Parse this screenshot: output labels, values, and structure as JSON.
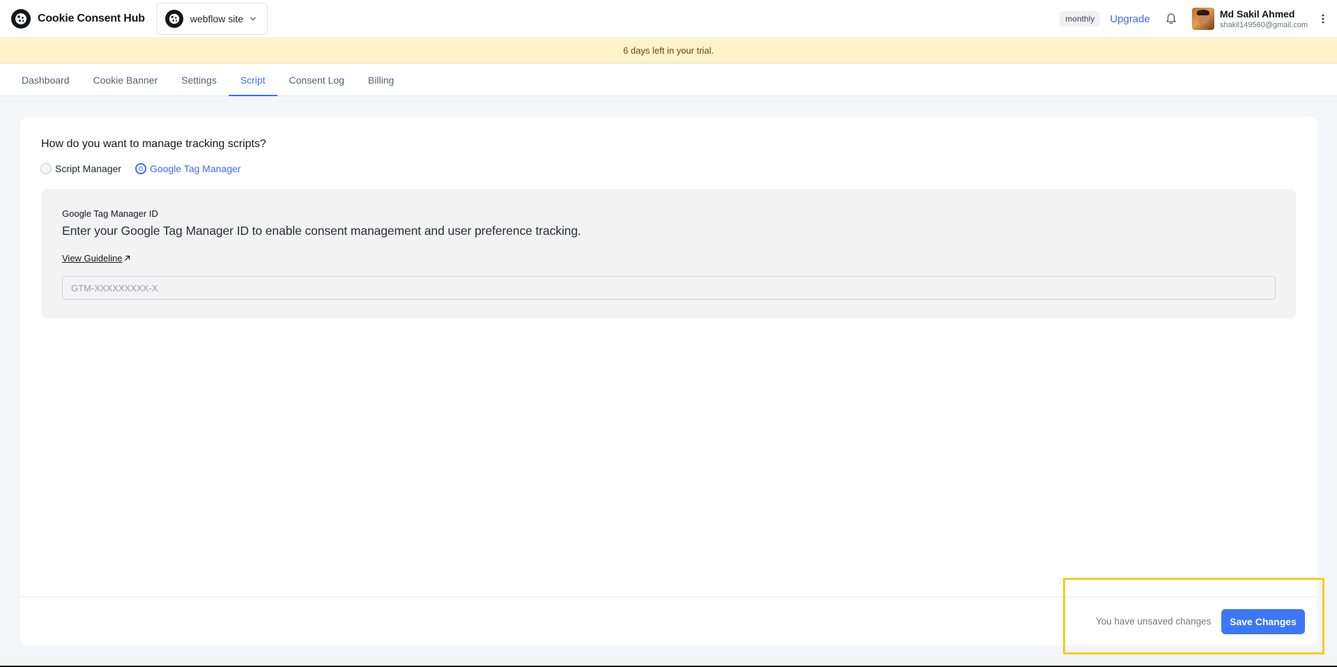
{
  "header": {
    "brand_name": "Cookie Consent Hub",
    "site_selector": {
      "label": "webflow site",
      "icon": "chevron-down-icon"
    },
    "plan_badge": "monthly",
    "upgrade_label": "Upgrade",
    "notification_icon": "bell-icon",
    "user": {
      "name": "Md Sakil Ahmed",
      "email": "shakil149560@gmail.com"
    },
    "menu_icon": "kebab-menu-icon"
  },
  "trial_banner": {
    "text": "6 days left in your trial."
  },
  "tabs": [
    {
      "label": "Dashboard",
      "active": false
    },
    {
      "label": "Cookie Banner",
      "active": false
    },
    {
      "label": "Settings",
      "active": false
    },
    {
      "label": "Script",
      "active": true
    },
    {
      "label": "Consent Log",
      "active": false
    },
    {
      "label": "Billing",
      "active": false
    }
  ],
  "script_settings": {
    "question": "How do you want to manage tracking scripts?",
    "options": [
      {
        "label": "Script Manager",
        "selected": false
      },
      {
        "label": "Google Tag Manager",
        "selected": true
      }
    ],
    "gtm": {
      "title": "Google Tag Manager ID",
      "description": "Enter your Google Tag Manager ID to enable consent management and user preference tracking.",
      "guideline_link": "View Guideline",
      "input_value": "",
      "input_placeholder": "GTM-XXXXXXXXX-X"
    }
  },
  "footer_bar": {
    "unsaved_text": "You have unsaved changes",
    "save_label": "Save Changes"
  },
  "colors": {
    "accent": "#3b6df0",
    "save_button": "#3b77f6",
    "trial_banner_bg": "#fdf3c8",
    "highlight": "#f7cc1b"
  }
}
